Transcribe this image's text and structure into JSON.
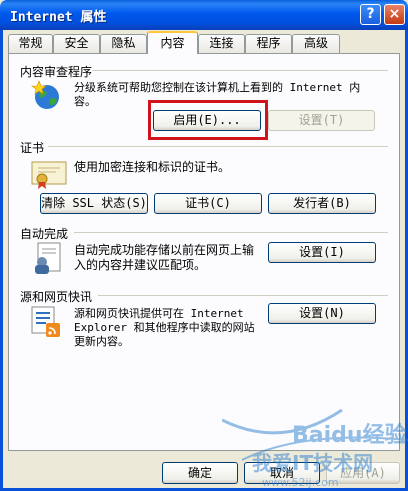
{
  "window": {
    "title": "Internet 属性",
    "help_label": "?",
    "close_label": "×"
  },
  "tabs": [
    "常规",
    "安全",
    "隐私",
    "内容",
    "连接",
    "程序",
    "高级"
  ],
  "content_advisor": {
    "heading": "内容审查程序",
    "desc_line1": "分级系统可帮助您控制在该计算机上看到的 Internet 内",
    "desc_line2": "容。",
    "enable_button": "启用(E)...",
    "settings_button": "设置(T)"
  },
  "certificates": {
    "heading": "证书",
    "desc": "使用加密连接和标识的证书。",
    "clear_ssl_button": "清除 SSL 状态(S)",
    "certificates_button": "证书(C)",
    "publishers_button": "发行者(B)"
  },
  "autocomplete": {
    "heading": "自动完成",
    "desc_line1": "自动完成功能存储以前在网页上输",
    "desc_line2": "入的内容并建议匹配项。",
    "settings_button": "设置(I)"
  },
  "feeds": {
    "heading": "源和网页快讯",
    "desc_line1": "源和网页快讯提供可在 Internet",
    "desc_line2": "Explorer 和其他程序中读取的网站",
    "desc_line3": "更新内容。",
    "settings_button": "设置(N)"
  },
  "footer": {
    "ok_button": "确定",
    "cancel_button": "取消",
    "apply_button": "应用(A)"
  },
  "watermark": {
    "logo_text": "Baidu经验",
    "site_text": "我爱IT技术网",
    "url_text": "www.52ij.com"
  },
  "colors": {
    "titlebar": "#0058ee",
    "highlight_box": "#d0121c",
    "panel": "#fcfcfe",
    "dialog": "#ece9d8"
  }
}
